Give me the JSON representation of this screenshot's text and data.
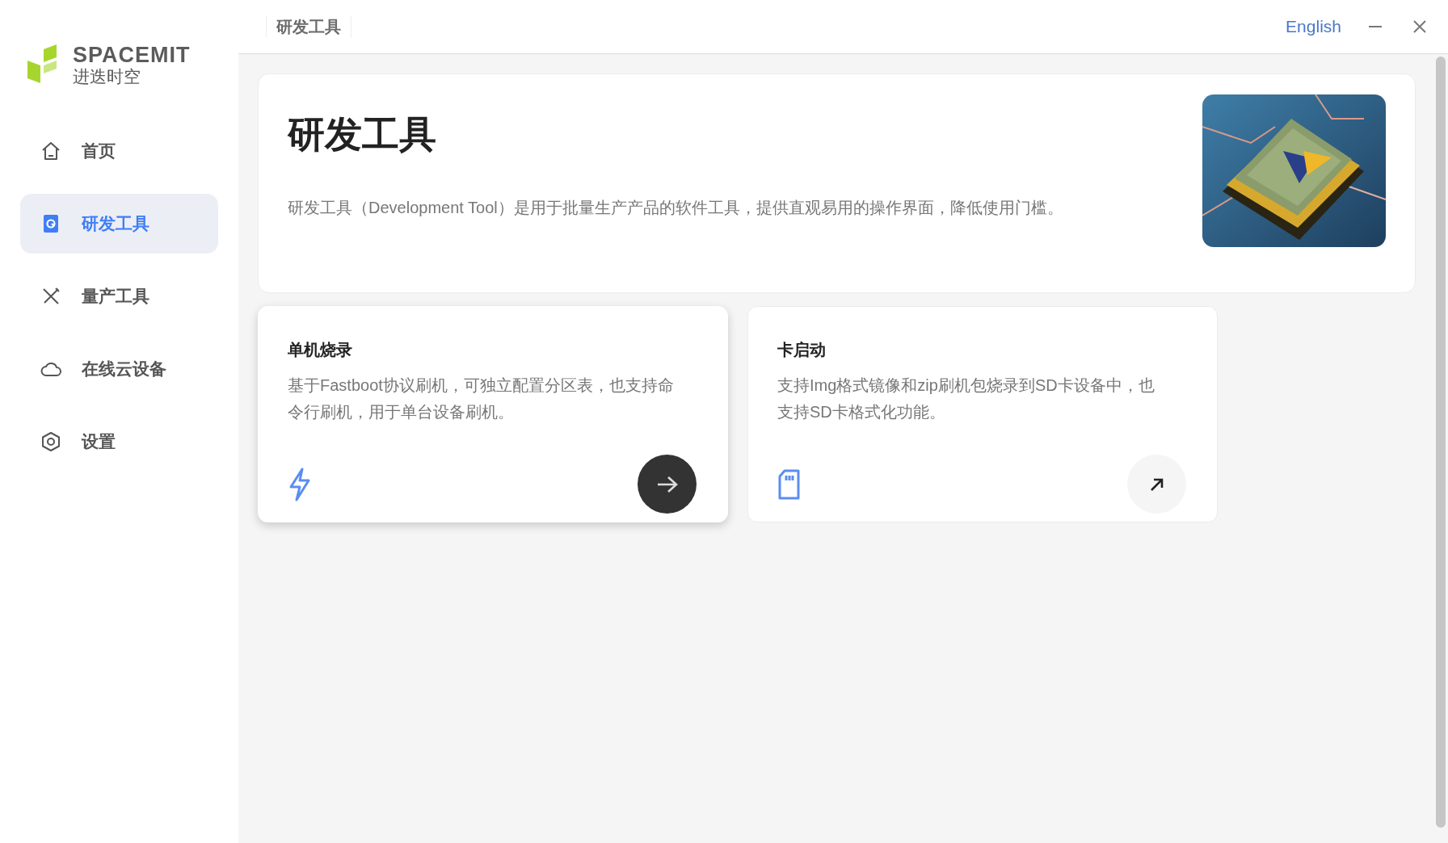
{
  "logo": {
    "name": "SPACEMIT",
    "subtitle": "进迭时空"
  },
  "sidebar": {
    "items": [
      {
        "label": "首页",
        "kind": "home",
        "selected": false
      },
      {
        "label": "研发工具",
        "kind": "dev",
        "selected": true
      },
      {
        "label": "量产工具",
        "kind": "tools",
        "selected": false
      },
      {
        "label": "在线云设备",
        "kind": "cloud",
        "selected": false
      },
      {
        "label": "设置",
        "kind": "settings",
        "selected": false
      }
    ]
  },
  "top_bar": {
    "breadcrumb": "研发工具",
    "language": "English"
  },
  "hero": {
    "title": "研发工具",
    "description": "研发工具（Development Tool）是用于批量生产产品的软件工具，提供直观易用的操作界面，降低使用门槛。"
  },
  "cards": [
    {
      "title": "单机烧录",
      "description": "基于Fastboot协议刷机，可独立配置分区表，也支持命令行刷机，用于单台设备刷机。",
      "kind": "flash",
      "highlighted": true
    },
    {
      "title": "卡启动",
      "description": "支持Img格式镜像和zip刷机包烧录到SD卡设备中，也支持SD卡格式化功能。",
      "kind": "sdcard",
      "highlighted": false
    }
  ]
}
